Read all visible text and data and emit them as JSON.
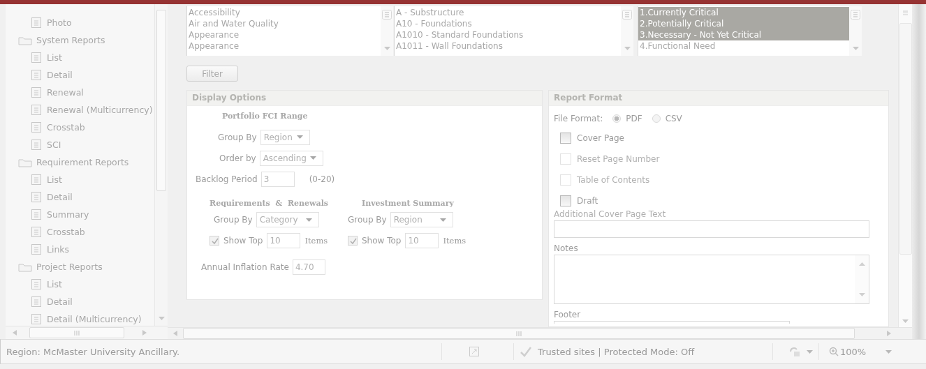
{
  "tree": [
    {
      "kind": "report",
      "label": "Photo"
    },
    {
      "kind": "folder",
      "label": "System Reports",
      "children": [
        {
          "kind": "report",
          "label": "List"
        },
        {
          "kind": "report",
          "label": "Detail"
        },
        {
          "kind": "report",
          "label": "Renewal"
        },
        {
          "kind": "report",
          "label": "Renewal (Multicurrency)"
        },
        {
          "kind": "report",
          "label": "Crosstab"
        },
        {
          "kind": "report",
          "label": "SCI"
        }
      ]
    },
    {
      "kind": "folder",
      "label": "Requirement Reports",
      "children": [
        {
          "kind": "report",
          "label": "List"
        },
        {
          "kind": "report",
          "label": "Detail"
        },
        {
          "kind": "report",
          "label": "Summary"
        },
        {
          "kind": "report",
          "label": "Crosstab"
        },
        {
          "kind": "report",
          "label": "Links"
        }
      ]
    },
    {
      "kind": "folder",
      "label": "Project Reports",
      "children": [
        {
          "kind": "report",
          "label": "List"
        },
        {
          "kind": "report",
          "label": "Detail"
        },
        {
          "kind": "report",
          "label": "Detail (Multicurrency)"
        }
      ]
    }
  ],
  "listboxes": [
    {
      "items": [
        {
          "label": "Accessibility",
          "selected": false
        },
        {
          "label": "Air and Water Quality",
          "selected": false
        },
        {
          "label": "Appearance",
          "selected": false
        },
        {
          "label": "Appearance",
          "selected": false
        }
      ]
    },
    {
      "items": [
        {
          "label": "A - Substructure",
          "selected": false
        },
        {
          "label": "A10 - Foundations",
          "selected": false
        },
        {
          "label": "A1010 - Standard Foundations",
          "selected": false
        },
        {
          "label": "A1011 - Wall Foundations",
          "selected": false
        }
      ]
    },
    {
      "items": [
        {
          "label": "1.Currently Critical",
          "selected": true
        },
        {
          "label": "2.Potentially Critical",
          "selected": true
        },
        {
          "label": "3.Necessary - Not Yet Critical",
          "selected": true
        },
        {
          "label": "4.Functional Need",
          "selected": false
        }
      ]
    }
  ],
  "filter_button": "Filter",
  "display_options": {
    "title": "Display Options",
    "portfolio": {
      "heading": "Portfolio FCI Range",
      "group_by": {
        "label": "Group By",
        "value": "Region"
      },
      "order_by": {
        "label": "Order by",
        "value": "Ascending"
      },
      "backlog": {
        "label": "Backlog Period",
        "value": "3",
        "hint": "(0-20)"
      }
    },
    "sections": [
      {
        "heading": "Requirements  &  Renewals",
        "group_by": {
          "label": "Group By",
          "value": "Category"
        },
        "show_top": {
          "checked": true,
          "label": "Show Top",
          "value": "10",
          "suffix": "Items"
        }
      },
      {
        "heading": "Investment Summary",
        "group_by": {
          "label": "Group By",
          "value": "Region"
        },
        "show_top": {
          "checked": true,
          "label": "Show Top",
          "value": "10",
          "suffix": "Items"
        }
      }
    ],
    "inflation": {
      "label": "Annual Inflation Rate",
      "value": "4.70"
    }
  },
  "report_format": {
    "title": "Report Format",
    "file_format": {
      "label": "File Format:",
      "options": [
        {
          "label": "PDF",
          "selected": true
        },
        {
          "label": "CSV",
          "selected": false
        }
      ]
    },
    "checkboxes": [
      {
        "label": "Cover Page",
        "checked": false,
        "disabled": false
      },
      {
        "label": "Reset Page Number",
        "checked": false,
        "disabled": true
      },
      {
        "label": "Table of Contents",
        "checked": false,
        "disabled": true
      },
      {
        "label": "Draft",
        "checked": false,
        "disabled": false
      }
    ],
    "cover_text_label": "Additional Cover Page Text",
    "notes_label": "Notes",
    "footer_label": "Footer"
  },
  "status_bar": {
    "text": "Region: McMaster University Ancillary.",
    "zone": "Trusted sites | Protected Mode: Off",
    "zoom": "100%"
  }
}
